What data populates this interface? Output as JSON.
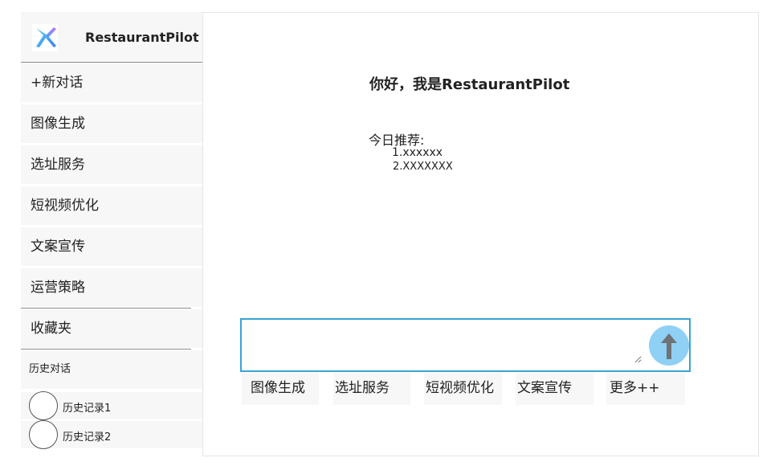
{
  "brand": {
    "name": "RestaurantPilot",
    "logo": "x-logo-icon"
  },
  "sidebar": {
    "items": [
      {
        "label": "+新对话"
      },
      {
        "label": "图像生成"
      },
      {
        "label": "选址服务"
      },
      {
        "label": "短视频优化"
      },
      {
        "label": "文案宣传"
      },
      {
        "label": "运营策略"
      },
      {
        "label": "收藏夹"
      }
    ],
    "history_title": "历史对话",
    "history": [
      {
        "label": "历史记录1"
      },
      {
        "label": "历史记录2"
      }
    ]
  },
  "main": {
    "greeting": "你好，我是RestaurantPilot",
    "recommend_title": "今日推荐:",
    "recommend_items": [
      "1.xxxxxx",
      "2.XXXXXXX"
    ],
    "input": {
      "value": "",
      "placeholder": ""
    },
    "send_icon": "arrow-up-icon",
    "quick_actions": [
      {
        "label": "图像生成"
      },
      {
        "label": "选址服务"
      },
      {
        "label": "短视频优化"
      },
      {
        "label": "文案宣传"
      },
      {
        "label": "更多++"
      }
    ]
  },
  "colors": {
    "accent_border": "#3aa3d2",
    "send_button": "#8fd0f5",
    "sidebar_bg": "#f7f7f7"
  }
}
